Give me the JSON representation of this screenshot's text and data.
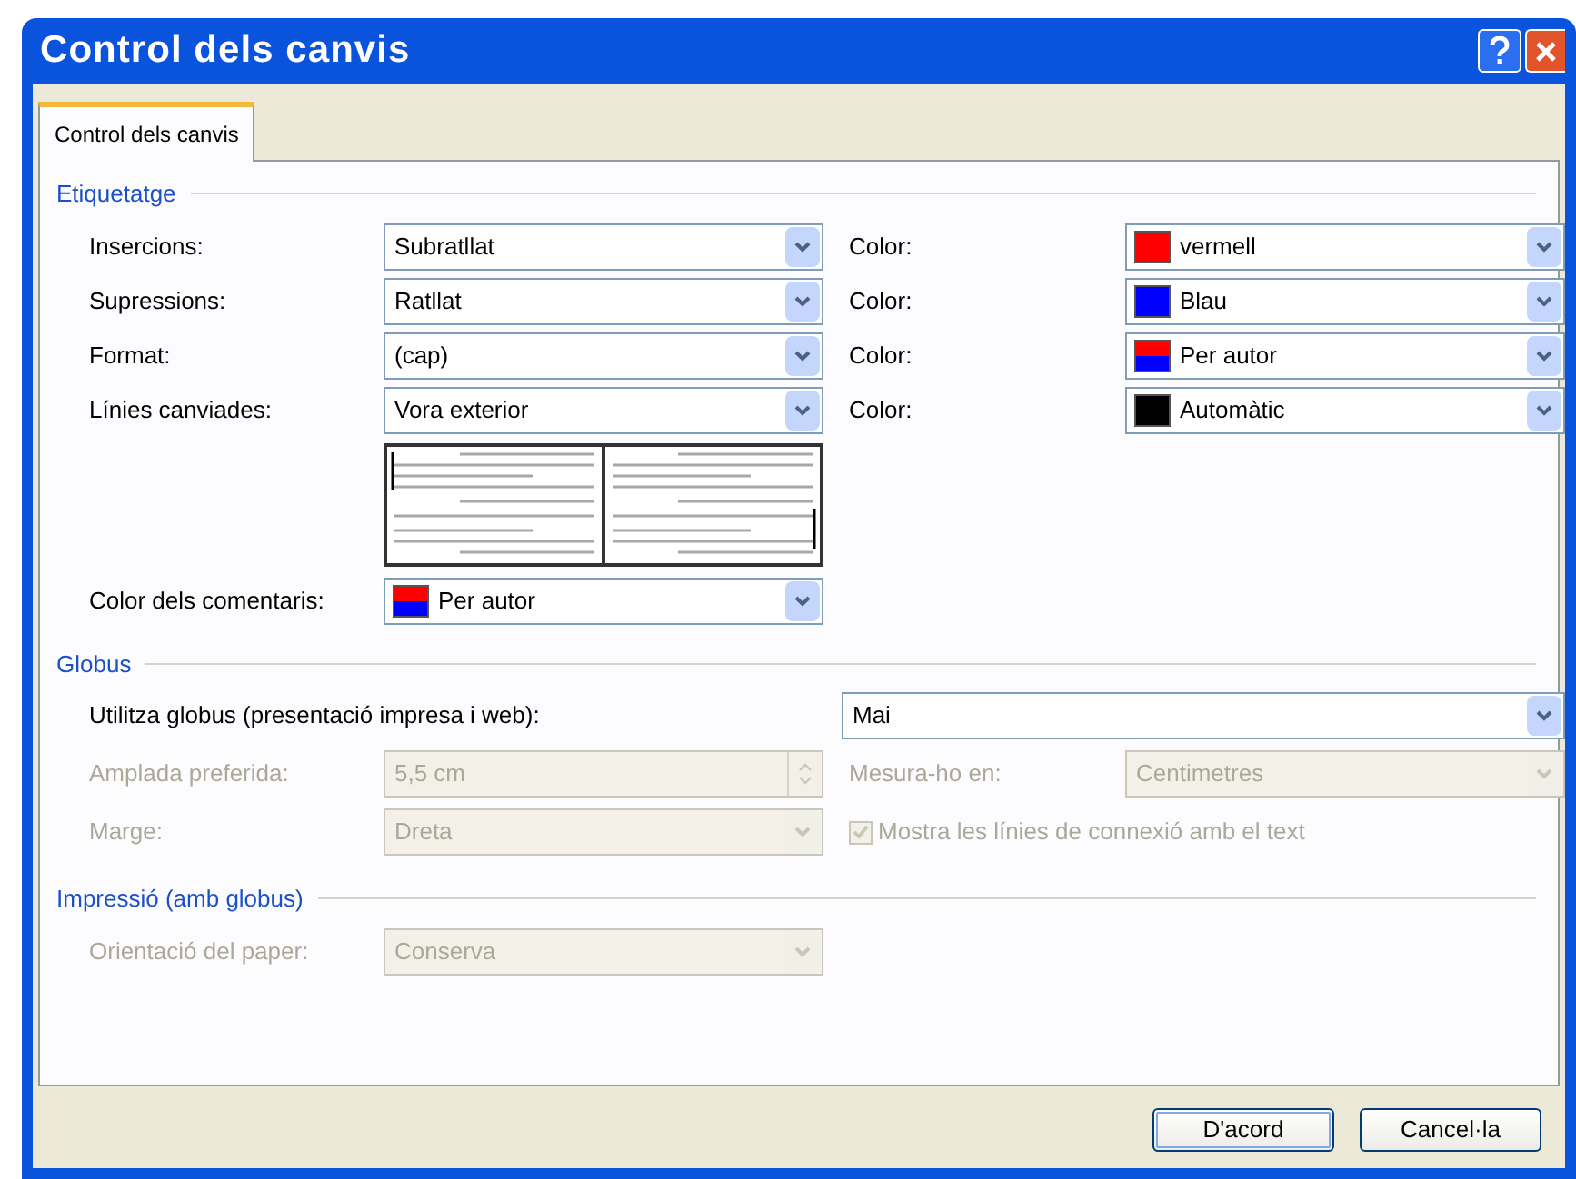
{
  "window": {
    "title": "Control dels canvis"
  },
  "tabs": [
    {
      "label": "Control dels canvis",
      "selected": true
    }
  ],
  "marking": {
    "heading": "Etiquetatge",
    "rows": [
      {
        "label": "Insercions:",
        "value": "Subratllat",
        "color_label": "Color:",
        "color_value": "vermell",
        "swatch": [
          {
            "color": "#ff0000"
          }
        ]
      },
      {
        "label": "Supressions:",
        "value": "Ratllat",
        "color_label": "Color:",
        "color_value": "Blau",
        "swatch": [
          {
            "color": "#0000ff"
          }
        ]
      },
      {
        "label": "Format:",
        "value": "(cap)",
        "color_label": "Color:",
        "color_value": "Per autor",
        "swatch": [
          {
            "color": "#ff0000"
          },
          {
            "color": "#0000ff"
          }
        ]
      },
      {
        "label": "Línies canviades:",
        "value": "Vora exterior",
        "color_label": "Color:",
        "color_value": "Automàtic",
        "swatch": [
          {
            "color": "#000000"
          }
        ]
      }
    ],
    "comments": {
      "label": "Color dels comentaris:",
      "value": "Per autor",
      "swatch": [
        {
          "color": "#ff0000"
        },
        {
          "color": "#0000ff"
        }
      ]
    }
  },
  "balloons": {
    "heading": "Globus",
    "use_label": "Utilitza globus (presentació impresa i web):",
    "use_value": "Mai",
    "width": {
      "label": "Amplada preferida:",
      "value": "5,5 cm",
      "kind": "spinner",
      "disabled": true
    },
    "measure": {
      "label": "Mesura-ho en:",
      "value": "Centimetres",
      "kind": "dropdown",
      "disabled": true
    },
    "margin": {
      "label": "Marge:",
      "value": "Dreta",
      "kind": "dropdown",
      "disabled": true
    },
    "connect": {
      "label": "Mostra les línies de connexió amb el text",
      "checked": true,
      "disabled": true
    }
  },
  "printing": {
    "heading": "Impressió (amb globus)",
    "orientation": {
      "label": "Orientació del paper:",
      "value": "Conserva",
      "kind": "dropdown",
      "disabled": true
    }
  },
  "buttons": [
    {
      "label": "D'acord",
      "default": true
    },
    {
      "label": "Cancel·la",
      "default": false
    }
  ]
}
